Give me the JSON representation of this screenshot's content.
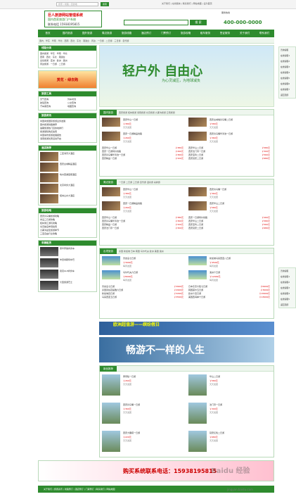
{
  "topbar": {
    "search_placeholder": "搜索 / 线路 / 目的地",
    "search_button": "搜索",
    "links": "关于我们 | 在线留言 | 联系我们 | 网站地图 | 设为首页"
  },
  "logo": {
    "line1": "巨人旅游网站管理系统",
    "line2": "国内首家旅游门户系统",
    "line3": "联系电话 15938195815"
  },
  "header": {
    "search_button": "搜 索",
    "hotline_label": "服务热线",
    "phone": "400-000-0000"
  },
  "nav": {
    "items": [
      "首页",
      "国内旅游",
      "国外旅游",
      "周边旅游",
      "旅游线路",
      "酒店预订",
      "门票预订",
      "旅游攻略",
      "租车服务",
      "签证服务",
      "关于我们",
      "联系我们"
    ]
  },
  "subnav": {
    "text": "国内 · 华东 · 华南 · 华北 · 西南 · 西北 · 东北 · 港澳台 · 周边 · 一日游 · 二日游 · 三日游 · 自驾游"
  },
  "left": {
    "box1": {
      "title": "线路分类",
      "items": [
        "国内旅游 · 华东 · 华南 · 华北",
        "西南 · 西北 · 东北 · 港澳台",
        "出境旅游 · 亚洲 · 欧洲 · 美洲",
        "周边旅游 · 一日游 · 二日游"
      ]
    },
    "promo": "赏花 · 绿去购",
    "box2": {
      "title": "旅游工具",
      "items": [
        "天气查询",
        "列车时刻",
        "航班查询",
        "公交查询",
        "汽车票查询",
        "地图查询"
      ]
    },
    "box3": {
      "title": "旅游资讯",
      "items": [
        "中国青旅国际旅游业务发展",
        "国内旅游线路推荐",
        "暑期旅游热门目的地排行",
        "旅游保险购买指南",
        "中国城市旅游发展报告",
        "海南旅游优惠活动开启"
      ]
    },
    "box4": {
      "title": "酒店推荐",
      "items": [
        "三亚海景大酒店",
        "西安古城精品酒店",
        "杭州西湖度假酒店",
        "北京商务大酒店",
        "桂林山水大酒店"
      ]
    },
    "box5": {
      "title": "旅游攻略",
      "items": [
        "西安兵马俑旅游攻略",
        "青岛三日游攻略",
        "桂林漓江游玩攻略",
        "北京故宫参观指南",
        "九寨沟最佳旅游季节",
        "三亚自由行全攻略"
      ]
    },
    "box6": {
      "title": "车辆租赁",
      "items": [
        "豪华奔驰商务车",
        "丰田考斯特中巴",
        "别克GL8商务车",
        "大型旅游巴士"
      ]
    }
  },
  "banner": {
    "title": "轻户外 自由心",
    "subtitle": "为心灵减压，为地球减负"
  },
  "sections": [
    {
      "title": "国内旅游",
      "links": "西安旅游 桂林旅游 海南旅游 北京旅游 九寨沟旅游 云南旅游"
    },
    {
      "title": "周边旅游",
      "links": "一日游 二日游 三日游 自驾游 温泉游 采摘游"
    },
    {
      "title": "出境旅游",
      "links": "泰国 新加坡 日本 韩国 马尔代夫 欧洲 美国 澳洲"
    },
    {
      "title": "新品推荐",
      "links": ""
    }
  ],
  "items": {
    "s1": [
      {
        "title": "西安华山一日游",
        "price": "￥380元",
        "date": "天天发团"
      },
      {
        "title": "西安古城墙兵马俑二日游",
        "price": "￥580元",
        "date": "天天发团"
      },
      {
        "title": "西安一日游精品线路",
        "price": "￥260元",
        "date": "天天发团"
      },
      {
        "title": "西安兵马俑华清池一日游",
        "price": "￥360元",
        "date": "天天发团"
      }
    ],
    "s1list": [
      "西安华山一日游",
      "西安一日游特价线路",
      "西安兵马俑华清池一日游",
      "西安精品一日游",
      "西安华山二日游",
      "西安法门寺一日游",
      "西安宝鸡二日游",
      "西安延安二日游"
    ],
    "s1prices": [
      "￥380元",
      "￥260元",
      "￥360元",
      "￥320元",
      "￥580元",
      "￥300元",
      "￥560元",
      "￥680元"
    ],
    "s2": [
      {
        "title": "西安华山一日游",
        "price": "￥380元",
        "date": "天天发团"
      },
      {
        "title": "西安兵马俑一日游",
        "price": "￥360元",
        "date": "天天发团"
      },
      {
        "title": "西安一日游精品线路",
        "price": "￥260元",
        "date": "天天发团"
      },
      {
        "title": "西安华山二日游",
        "price": "￥580元",
        "date": "天天发团"
      }
    ],
    "s3": [
      {
        "title": "普吉岛七日游",
        "price": "￥3999元",
        "date": "每周发团"
      },
      {
        "title": "新加坡马来西亚八日游",
        "price": "￥4599元",
        "date": "每周发团"
      },
      {
        "title": "马尔代夫六日游",
        "price": "￥8999元",
        "date": "每周发团"
      },
      {
        "title": "澳洲十日游",
        "price": "￥12999元",
        "date": "每周发团"
      }
    ],
    "s3list": [
      "普吉岛七日游",
      "泰国曼谷芭提雅六日游",
      "新加坡四日游",
      "马来西亚五日游",
      "日本东京大阪七日游",
      "韩国首尔五日游",
      "欧洲十四日游",
      "美国西海岸十日游"
    ],
    "s3prices": [
      "￥3999元",
      "￥2999元",
      "￥3299元",
      "￥3599元",
      "￥6999元",
      "￥3999元",
      "￥15999元",
      "￥13999元"
    ],
    "s4": [
      {
        "title": "黄帝陵一日游",
        "price": "￥260元",
        "date": "天天发团"
      },
      {
        "title": "华山二日游",
        "price": "￥580元",
        "date": "天天发团"
      },
      {
        "title": "西安兵马俑一日游",
        "price": "￥360元",
        "date": "天天发团"
      },
      {
        "title": "法门寺一日游",
        "price": "￥300元",
        "date": "天天发团"
      },
      {
        "title": "西安大雁塔一日游",
        "price": "￥220元",
        "date": "天天发团"
      },
      {
        "title": "延安红色二日游",
        "price": "￥680元",
        "date": "天天发团"
      }
    ]
  },
  "ads": {
    "ad1": "欧洲超值游——缤纷假日",
    "ad2": "畅游不一样的人生"
  },
  "footer": {
    "ad": "购买系统联系电话：15938195815",
    "nav": "关于我们 | 旅游资讯 | 线路预订 | 酒店预订 | 门票预订 | 联系我们 | 网站地图"
  },
  "right": {
    "items": [
      "咨询客服",
      "在线客服1",
      "在线客服2",
      "在线客服3",
      "在线客服4",
      "在线客服5",
      "在线客服6",
      "在线客服7",
      "返回顶部"
    ]
  },
  "watermark": {
    "big": "Baidu 经验",
    "small": "jingyan.baidu.com"
  }
}
